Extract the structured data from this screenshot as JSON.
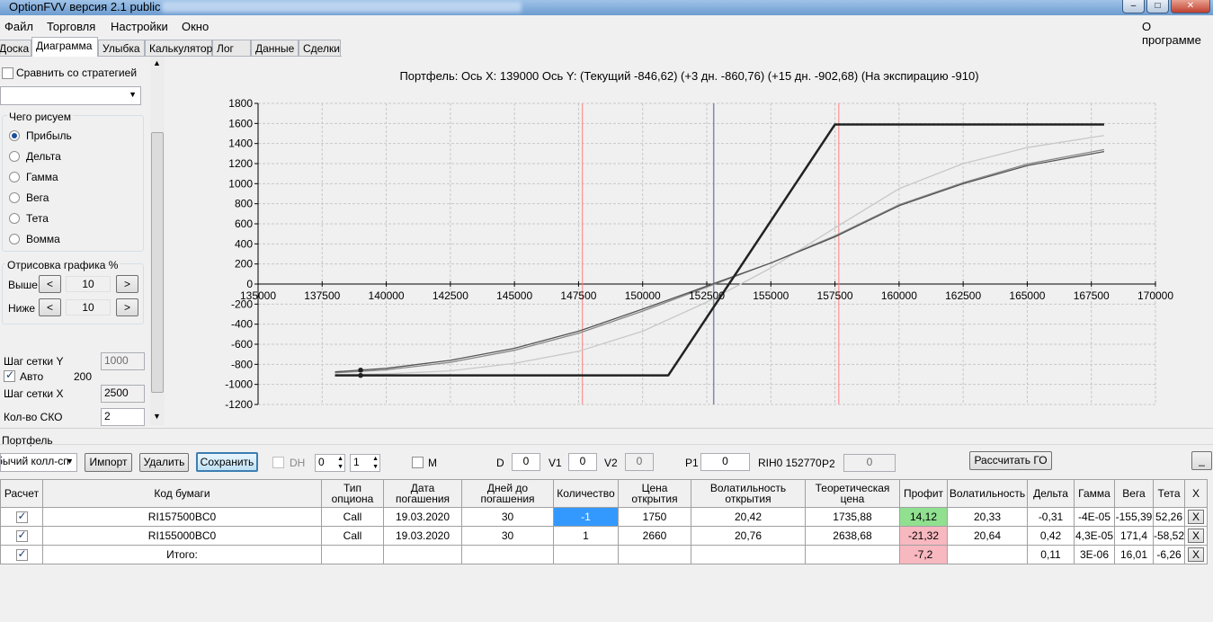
{
  "window": {
    "title": "OptionFVV версия 2.1 public",
    "min": "–",
    "max": "□",
    "close": "✕"
  },
  "menu": {
    "items": [
      "Файл",
      "Торговля",
      "Настройки",
      "Окно"
    ],
    "about": "О программе"
  },
  "tabs": [
    "Доска",
    "Диаграмма",
    "Улыбка",
    "Калькулятор",
    "Лог",
    "Данные",
    "Сделки"
  ],
  "active_tab": "Диаграмма",
  "left_panel": {
    "compare_label": "Сравнить со стратегией",
    "draw_group_title": "Чего рисуем",
    "draw_options": [
      "Прибыль",
      "Дельта",
      "Гамма",
      "Вега",
      "Тета",
      "Вомма"
    ],
    "selected_option": "Прибыль",
    "render_group_title": "Отрисовка графика %",
    "above_label": "Выше",
    "above_value": "10",
    "below_label": "Ниже",
    "below_value": "10",
    "grid_y_label": "Шаг сетки Y",
    "grid_y_value": "1000",
    "auto_label": "Авто",
    "auto_value": "200",
    "grid_x_label": "Шаг сетки X",
    "grid_x_value": "2500",
    "sko_label": "Кол-во СКО",
    "sko_value": "2"
  },
  "chart_header": "Портфель: Ось X: 139000 Ось Y:  (Текущий -846,62)  (+3 дн. -860,76)  (+15 дн. -902,68)  (На экспирацию -910)",
  "chart_data": {
    "type": "line",
    "xlim": [
      135000,
      170000
    ],
    "ylim": [
      -1200,
      1800
    ],
    "x_ticks": [
      "135000",
      "137500",
      "140000",
      "142500",
      "145000",
      "147500",
      "150000",
      "152500",
      "155000",
      "157500",
      "160000",
      "162500",
      "165000",
      "167500",
      "170000"
    ],
    "y_ticks": [
      "1800",
      "1600",
      "1400",
      "1200",
      "1000",
      "800",
      "600",
      "400",
      "200",
      "0",
      "-200",
      "-400",
      "-600",
      "-800",
      "-1000",
      "-1200"
    ],
    "grid": true,
    "vlines": [
      {
        "x": 147650,
        "color": "#ff8080"
      },
      {
        "x": 152770,
        "color": "#7d8ea8"
      },
      {
        "x": 157650,
        "color": "#ff8080"
      }
    ],
    "cursor_x": 139000,
    "series": [
      {
        "color": "#222222",
        "x": [
          138000,
          151000,
          157500,
          168000
        ],
        "y": [
          -910,
          -910,
          1590,
          1590
        ]
      },
      {
        "color": "#555555",
        "x": [
          138000,
          140000,
          142500,
          145000,
          147500,
          150000,
          152500,
          155000,
          157500,
          160000,
          162500,
          165000,
          168000
        ],
        "y": [
          -875,
          -840,
          -760,
          -640,
          -470,
          -250,
          -20,
          210,
          470,
          780,
          1000,
          1180,
          1320
        ]
      },
      {
        "color": "#888888",
        "x": [
          138000,
          140000,
          142500,
          145000,
          147500,
          150000,
          152500,
          155000,
          157500,
          160000,
          162500,
          165000,
          168000
        ],
        "y": [
          -885,
          -855,
          -780,
          -660,
          -490,
          -270,
          -30,
          210,
          480,
          790,
          1010,
          1195,
          1340
        ]
      },
      {
        "color": "#c8c8c8",
        "x": [
          138000,
          140000,
          142500,
          145000,
          147500,
          150000,
          152500,
          155000,
          157500,
          160000,
          162500,
          165000,
          168000
        ],
        "y": [
          -905,
          -895,
          -865,
          -790,
          -670,
          -470,
          -180,
          160,
          560,
          950,
          1200,
          1360,
          1480
        ]
      }
    ]
  },
  "portfolio": {
    "label": "Портфель",
    "strategy": "бычий колл-сп",
    "import_label": "Импорт",
    "delete_label": "Удалить",
    "save_label": "Сохранить",
    "dh_label": "DH",
    "dh_val1": "0",
    "dh_val2": "1",
    "m_label": "M",
    "d_label": "D",
    "d_value": "0",
    "v1_label": "V1",
    "v1_value": "0",
    "v2_label": "V2",
    "v2_value": "0",
    "p1_label": "P1",
    "p1_value": "0",
    "rih_label": "RIH0 152770",
    "p2_label": "P2",
    "p2_value": "0",
    "calc_label": "Рассчитать ГО",
    "minimize_label": "_"
  },
  "table": {
    "headers": [
      "Расчет",
      "Код бумаги",
      "Тип опциона",
      "Дата погашения",
      "Дней до погашения",
      "Количество",
      "Цена открытия",
      "Волатильность открытия",
      "Теоретическая цена",
      "Профит",
      "Волатильность",
      "Дельта",
      "Гамма",
      "Вега",
      "Тета",
      "X"
    ],
    "rows": [
      {
        "code": "RI157500BC0",
        "type": "Call",
        "date": "19.03.2020",
        "days": "30",
        "qty": "-1",
        "price": "1750",
        "vol_open": "20,42",
        "theo": "1735,88",
        "profit": "14,12",
        "vol": "20,33",
        "delta": "-0,31",
        "gamma": "-4E-05",
        "vega": "-155,39",
        "theta": "52,26",
        "x": "X"
      },
      {
        "code": "RI155000BC0",
        "type": "Call",
        "date": "19.03.2020",
        "days": "30",
        "qty": "1",
        "price": "2660",
        "vol_open": "20,76",
        "theo": "2638,68",
        "profit": "-21,32",
        "vol": "20,64",
        "delta": "0,42",
        "gamma": "4,3E-05",
        "vega": "171,4",
        "theta": "-58,52",
        "x": "X"
      }
    ],
    "total": {
      "code": "Итого:",
      "profit": "-7,2",
      "delta": "0,11",
      "gamma": "3E-06",
      "vega": "16,01",
      "theta": "-6,26",
      "x": "X"
    }
  },
  "colors": {
    "profit_pos": "#90e090",
    "profit_neg": "#f8b8c0",
    "qty_selected": "#3399ff"
  }
}
